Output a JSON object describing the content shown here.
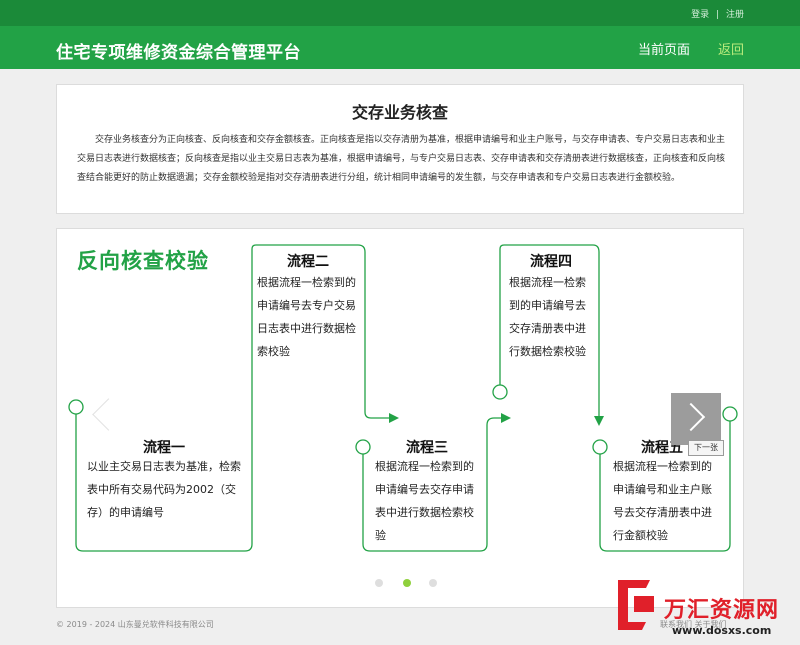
{
  "header": {
    "login": "登录",
    "sep": "|",
    "register": "注册",
    "brand": "住宅专项维修资金综合管理平台",
    "current_page": "当前页面",
    "back": "返回"
  },
  "intro": {
    "title": "交存业务核查",
    "description": "交存业务核查分为正向核查、反向核查和交存金额核查。正向核查是指以交存清册为基准，根据申请编号和业主户账号，与交存申请表、专户交易日志表和业主交易日志表进行数据核查；反向核查是指以业主交易日志表为基准，根据申请编号，与专户交易日志表、交存申请表和交存清册表进行数据核查，正向核查和反向核查结合能更好的防止数据遗漏；交存金额校验是指对交存清册表进行分组，统计相同申请编号的发生额，与交存申请表和专户交易日志表进行金额校验。"
  },
  "slide": {
    "title": "反向核查校验",
    "steps": [
      {
        "title": "流程一",
        "desc": "以业主交易日志表为基准，检索表中所有交易代码为2002（交存）的申请编号"
      },
      {
        "title": "流程二",
        "desc": "根据流程一检索到的申请编号去专户交易日志表中进行数据检索校验"
      },
      {
        "title": "流程三",
        "desc": "根据流程一检索到的申请编号去交存申请表中进行数据检索校验"
      },
      {
        "title": "流程四",
        "desc": "根据流程一检索到的申请编号去交存清册表中进行数据检索校验"
      },
      {
        "title": "流程五",
        "desc": "根据流程一检索到的申请编号和业主户账号去交存清册表中进行金额校验"
      }
    ],
    "next_tooltip": "下一张",
    "active_dot": 1,
    "dot_count": 3,
    "accent_color": "#22a246"
  },
  "footer": {
    "copyright": "© 2019 - 2024 山东曼兑软件科技有限公司",
    "links": "联系我们  关于我们"
  },
  "watermark": {
    "text": "万汇资源网",
    "url": "www.dosxs.com"
  }
}
